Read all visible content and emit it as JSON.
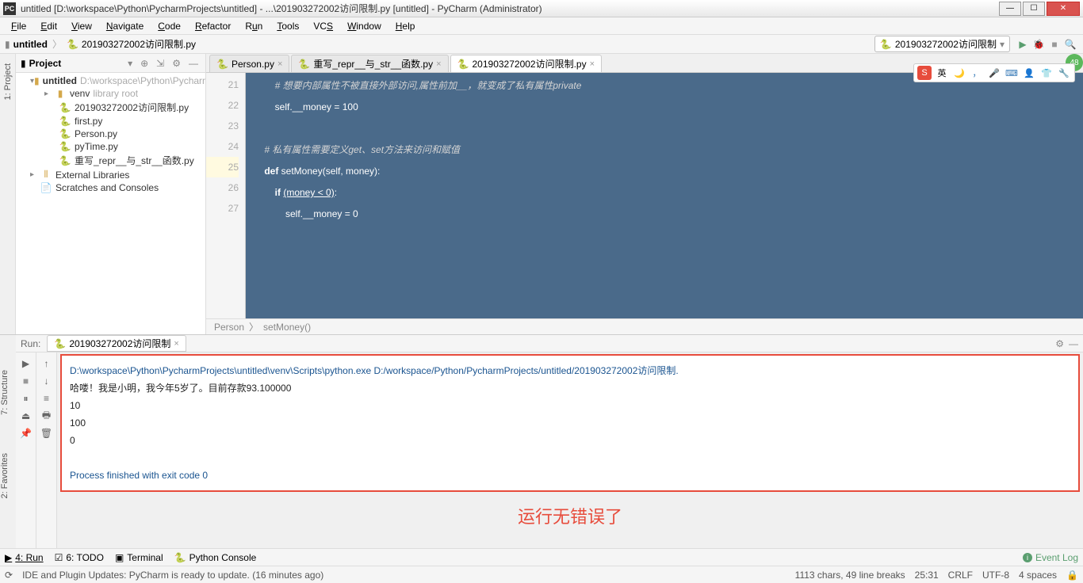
{
  "titlebar": {
    "icon": "PC",
    "text": "untitled [D:\\workspace\\Python\\PycharmProjects\\untitled] - ...\\201903272002访问限制.py [untitled] - PyCharm (Administrator)"
  },
  "menubar": [
    "File",
    "Edit",
    "View",
    "Navigate",
    "Code",
    "Refactor",
    "Run",
    "Tools",
    "VCS",
    "Window",
    "Help"
  ],
  "navbar": {
    "project": "untitled",
    "file": "201903272002访问限制.py",
    "run_config": "201903272002访问限制",
    "badge": "48"
  },
  "left_rail": [
    "1: Project",
    "7: Structure",
    "2: Favorites"
  ],
  "project": {
    "title": "Project",
    "tree": {
      "root": {
        "label": "untitled",
        "hint": "D:\\workspace\\Python\\PycharmProjects\\untitled"
      },
      "venv": {
        "label": "venv",
        "hint": "library root"
      },
      "files": [
        "201903272002访问限制.py",
        "first.py",
        "Person.py",
        "pyTime.py",
        "重写_repr__与_str__函数.py"
      ],
      "ext_lib": "External Libraries",
      "scratch": "Scratches and Consoles"
    }
  },
  "editor": {
    "tabs": [
      "Person.py",
      "重写_repr__与_str__函数.py",
      "201903272002访问限制.py"
    ],
    "active_tab": 2,
    "gutter": [
      "21",
      "22",
      "23",
      "24",
      "25",
      "26",
      "27"
    ],
    "code": {
      "l21": "        # 想要内部属性不被直接外部访问,属性前加__，就变成了私有属性private",
      "l22": "        self.__money = 100",
      "l23": "",
      "l24": "    # 私有属性需要定义get、set方法来访问和赋值",
      "l25_def": "    def ",
      "l25_fn": "setMoney",
      "l25_rest": "(self, money):",
      "l26_if": "        if ",
      "l26_cond": "(money < 0)",
      "l26_colon": ":",
      "l27": "            self.__money = 0"
    },
    "breadcrumb": [
      "Person",
      "setMoney()"
    ]
  },
  "ime": {
    "s": "S",
    "lang": "英"
  },
  "run": {
    "label": "Run:",
    "tab": "201903272002访问限制",
    "cmd": "D:\\workspace\\Python\\PycharmProjects\\untitled\\venv\\Scripts\\python.exe D:/workspace/Python/PycharmProjects/untitled/201903272002访问限制.",
    "out1": "哈喽！我是小明，我今年5岁了。目前存款93.100000",
    "out2": "10",
    "out3": "100",
    "out4": "0",
    "exit": "Process finished with exit code 0"
  },
  "annotation": "运行无错误了",
  "bottom_tabs": {
    "run": "4: Run",
    "todo": "6: TODO",
    "terminal": "Terminal",
    "pyconsole": "Python Console",
    "event_log": "Event Log"
  },
  "statusbar": {
    "msg": "IDE and Plugin Updates: PyCharm is ready to update. (16 minutes ago)",
    "chars": "1113 chars, 49 line breaks",
    "pos": "25:31",
    "crlf": "CRLF",
    "enc": "UTF-8",
    "indent": "4 spaces"
  }
}
